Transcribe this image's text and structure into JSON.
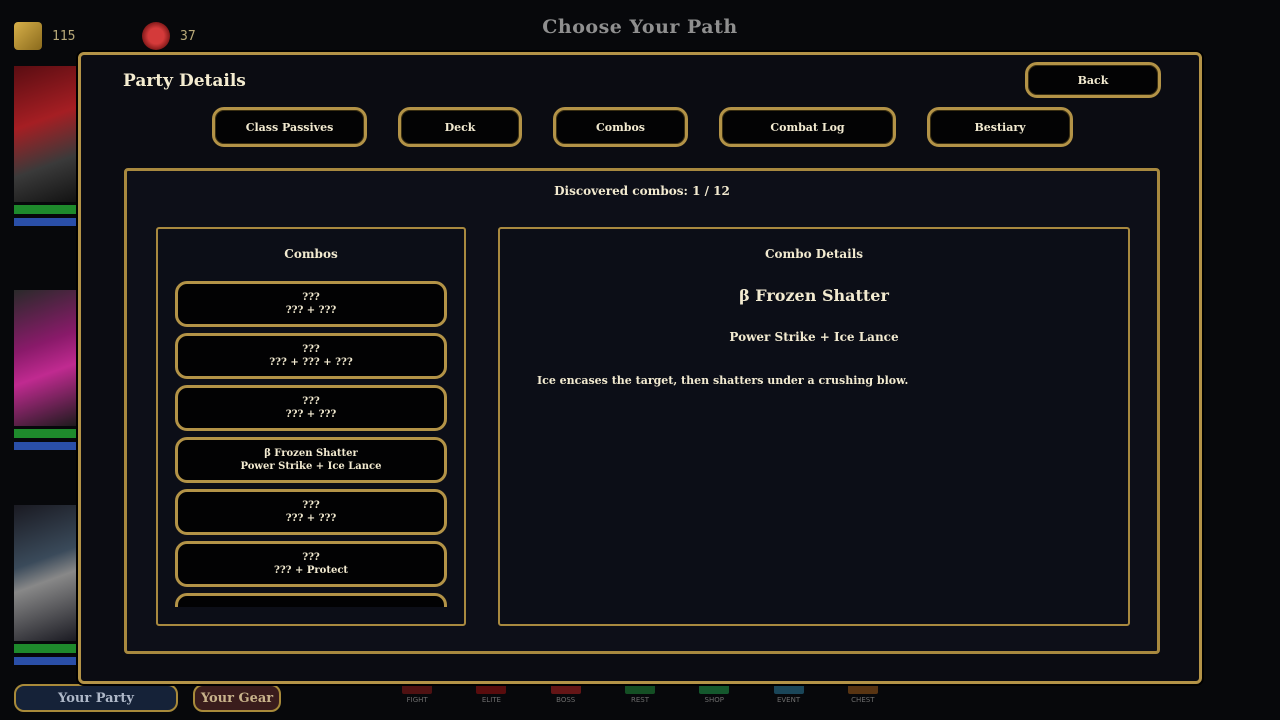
{
  "hud": {
    "gold": "115",
    "gems": "37",
    "title": "Choose Your Path"
  },
  "bottom_tabs": {
    "party": "Your Party",
    "gear": "Your Gear"
  },
  "map_legend": [
    "FIGHT",
    "ELITE",
    "BOSS",
    "REST",
    "SHOP",
    "EVENT",
    "CHEST"
  ],
  "colors": {
    "gold_border": "#b39347",
    "panel_bg": "#0c0e17",
    "text": "#f2ead0"
  },
  "modal": {
    "title": "Party Details",
    "back": "Back",
    "tabs": [
      "Class Passives",
      "Deck",
      "Combos",
      "Combat Log",
      "Bestiary"
    ],
    "discovered": "Discovered combos: 1 / 12",
    "list_title": "Combos",
    "combos": [
      {
        "name": "???",
        "recipe": "??? + ???"
      },
      {
        "name": "???",
        "recipe": "??? + ??? + ???"
      },
      {
        "name": "???",
        "recipe": "??? + ???"
      },
      {
        "name": "β Frozen Shatter",
        "recipe": "Power Strike + Ice Lance"
      },
      {
        "name": "???",
        "recipe": "??? + ???"
      },
      {
        "name": "???",
        "recipe": "??? + Protect"
      },
      {
        "name": "???",
        "recipe": ""
      }
    ],
    "details": {
      "title": "Combo Details",
      "name": "β Frozen Shatter",
      "recipe": "Power Strike + Ice Lance",
      "description": "Ice encases the target, then shatters under a crushing blow."
    }
  }
}
